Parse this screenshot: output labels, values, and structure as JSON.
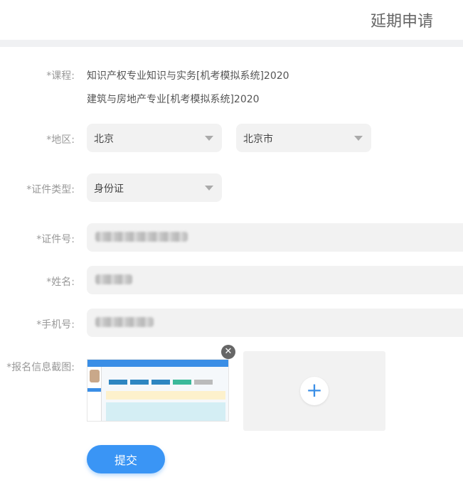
{
  "header": {
    "title": "延期申请"
  },
  "form": {
    "course_label": "*课程:",
    "courses": [
      "知识产权专业知识与实务[机考模拟系统]2020",
      "建筑与房地产专业[机考模拟系统]2020"
    ],
    "region_label": "*地区:",
    "province": "北京",
    "city": "北京市",
    "id_type_label": "*证件类型:",
    "id_type": "身份证",
    "id_number_label": "*证件号:",
    "name_label": "*姓名:",
    "phone_label": "*手机号:",
    "screenshot_label": "*报名信息截图:",
    "submit": "提交"
  },
  "colors": {
    "accent": "#3a95f5"
  }
}
